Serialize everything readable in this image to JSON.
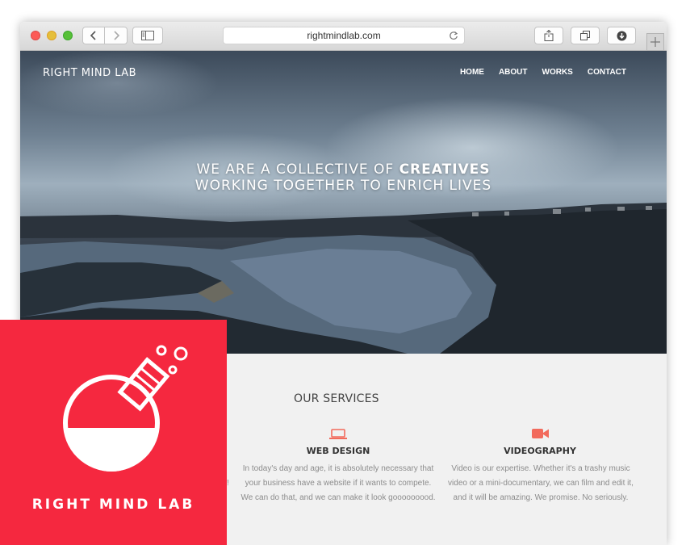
{
  "browser": {
    "url": "rightmindlab.com",
    "icons": [
      "back-icon",
      "forward-icon",
      "sidebar-icon",
      "reload-icon",
      "share-icon",
      "tabs-icon",
      "download-icon",
      "plus-icon"
    ]
  },
  "site": {
    "brand": "RIGHT MIND LAB",
    "nav": [
      "HOME",
      "ABOUT",
      "WORKS",
      "CONTACT"
    ],
    "hero": {
      "line1_prefix": "WE ARE A COLLECTIVE OF ",
      "line1_bold": "CREATIVES",
      "line2": "WORKING TOGETHER TO ENRICH LIVES"
    },
    "services": {
      "title": "OUR SERVICES",
      "partial_glyph": "!",
      "items": [
        {
          "icon": "laptop-icon",
          "title": "WEB DESIGN",
          "lines": [
            "In today's day and age, it is absolutely necessary that",
            "your business have a website if it wants to compete.",
            "We can do that, and we can make it look gooooooood."
          ]
        },
        {
          "icon": "video-camera-icon",
          "title": "VIDEOGRAPHY",
          "lines": [
            "Video is our expertise. Whether it's a trashy music",
            "video or a mini-documentary, we can film and edit it,",
            "and it will be amazing. We promise. No seriously."
          ]
        }
      ]
    }
  },
  "logo": {
    "text": "RIGHT MIND LAB",
    "icon": "flask-icon"
  },
  "colors": {
    "accent_red": "#f5283f",
    "service_icon": "#f26a5c",
    "section_bg": "#f1f1f1"
  }
}
